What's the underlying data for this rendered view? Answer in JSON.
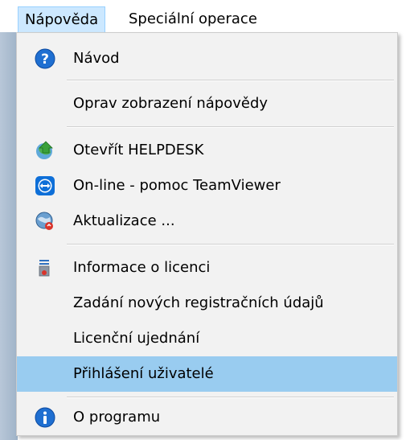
{
  "menubar": {
    "items": [
      {
        "label": "Nápověda"
      },
      {
        "label": "Speciální operace"
      }
    ]
  },
  "menu": {
    "items": [
      {
        "label": "Návod",
        "icon": "help-question-icon"
      },
      {
        "label": "Oprav zobrazení nápovědy",
        "icon": ""
      },
      {
        "label": "Otevřít HELPDESK",
        "icon": "helpdesk-globe-icon"
      },
      {
        "label": "On-line - pomoc TeamViewer",
        "icon": "teamviewer-icon"
      },
      {
        "label": "Aktualizace ...",
        "icon": "update-globe-icon"
      },
      {
        "label": "Informace o licenci",
        "icon": "license-info-icon"
      },
      {
        "label": "Zadání nových registračních údajů",
        "icon": ""
      },
      {
        "label": "Licenční ujednání",
        "icon": ""
      },
      {
        "label": "Přihlášení uživatelé",
        "icon": "",
        "highlighted": true
      },
      {
        "label": "O programu",
        "icon": "info-icon"
      }
    ]
  },
  "colors": {
    "menubar_active_bg": "#cce8ff",
    "menu_bg": "#f2f2f2",
    "highlight_bg": "#99ccf0",
    "left_strip": "#b8c7d8"
  }
}
